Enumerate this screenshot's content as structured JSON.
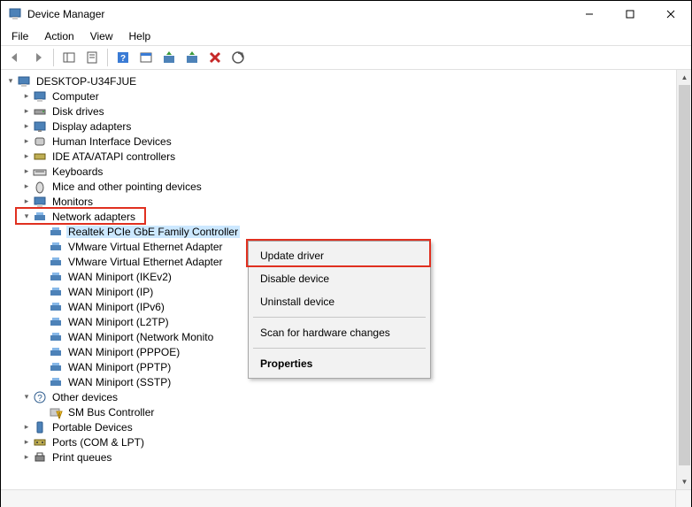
{
  "window": {
    "title": "Device Manager"
  },
  "menubar": [
    "File",
    "Action",
    "View",
    "Help"
  ],
  "tree": {
    "root": "DESKTOP-U34FJUE",
    "categories": [
      {
        "label": "Computer",
        "icon": "monitor"
      },
      {
        "label": "Disk drives",
        "icon": "disk"
      },
      {
        "label": "Display adapters",
        "icon": "display"
      },
      {
        "label": "Human Interface Devices",
        "icon": "hid"
      },
      {
        "label": "IDE ATA/ATAPI controllers",
        "icon": "ide"
      },
      {
        "label": "Keyboards",
        "icon": "keyboard"
      },
      {
        "label": "Mice and other pointing devices",
        "icon": "mouse"
      },
      {
        "label": "Monitors",
        "icon": "monitor"
      }
    ],
    "network_adapter_label": "Network adapters",
    "network_devices": [
      "Realtek PCIe GbE Family Controller",
      "VMware Virtual Ethernet Adapter",
      "VMware Virtual Ethernet Adapter",
      "WAN Miniport (IKEv2)",
      "WAN Miniport (IP)",
      "WAN Miniport (IPv6)",
      "WAN Miniport (L2TP)",
      "WAN Miniport (Network Monito",
      "WAN Miniport (PPPOE)",
      "WAN Miniport (PPTP)",
      "WAN Miniport (SSTP)"
    ],
    "other_devices_label": "Other devices",
    "other_devices": [
      "SM Bus Controller"
    ],
    "tail_categories": [
      {
        "label": "Portable Devices",
        "icon": "portable"
      },
      {
        "label": "Ports (COM & LPT)",
        "icon": "port"
      },
      {
        "label": "Print queues",
        "icon": "printer"
      }
    ]
  },
  "context_menu": {
    "update_driver": "Update driver",
    "disable_device": "Disable device",
    "uninstall_device": "Uninstall device",
    "scan": "Scan for hardware changes",
    "properties": "Properties"
  }
}
